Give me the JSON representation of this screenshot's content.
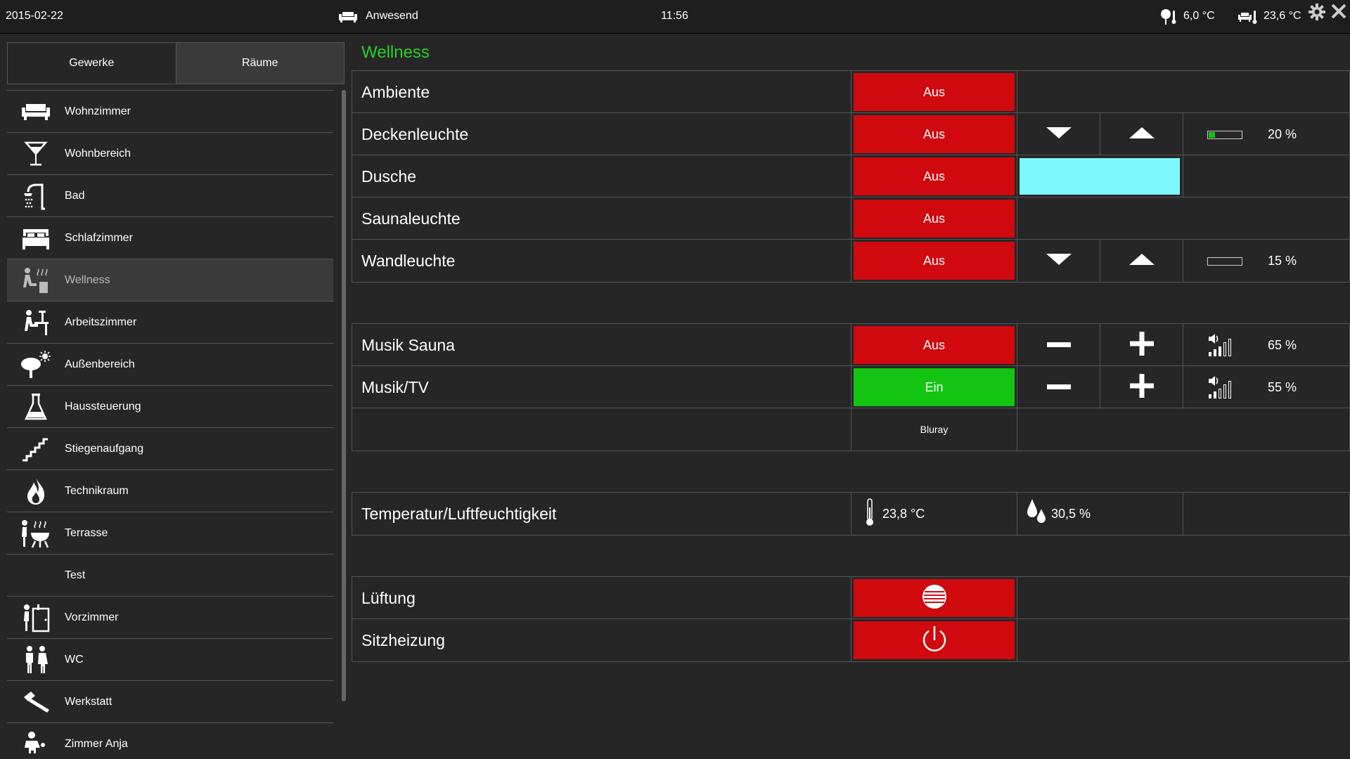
{
  "topbar": {
    "date": "2015-02-22",
    "presence": "Anwesend",
    "time": "11:56",
    "outdoor_temp": "6,0 °C",
    "indoor_temp": "23,6 °C"
  },
  "sidebar": {
    "tabs": [
      "Gewerke",
      "Räume"
    ],
    "rooms": [
      {
        "label": "Wohnzimmer",
        "icon": "sofa-icon"
      },
      {
        "label": "Wohnbereich",
        "icon": "cocktail-glass-icon"
      },
      {
        "label": "Bad",
        "icon": "shower-icon"
      },
      {
        "label": "Schlafzimmer",
        "icon": "bed-icon"
      },
      {
        "label": "Wellness",
        "icon": "sauna-icon"
      },
      {
        "label": "Arbeitszimmer",
        "icon": "desk-worker-icon"
      },
      {
        "label": "Außenbereich",
        "icon": "tree-sun-icon"
      },
      {
        "label": "Haussteuerung",
        "icon": "flask-icon"
      },
      {
        "label": "Stiegenaufgang",
        "icon": "stairs-icon"
      },
      {
        "label": "Technikraum",
        "icon": "flame-icon"
      },
      {
        "label": "Terrasse",
        "icon": "grill-icon"
      },
      {
        "label": "Test",
        "icon": ""
      },
      {
        "label": "Vorzimmer",
        "icon": "coat-rack-icon"
      },
      {
        "label": "WC",
        "icon": "restroom-icon"
      },
      {
        "label": "Werkstatt",
        "icon": "hammer-icon"
      },
      {
        "label": "Zimmer Anja",
        "icon": "child-icon"
      }
    ],
    "active": "Wellness"
  },
  "main": {
    "title": "Wellness",
    "lights": [
      {
        "label": "Ambiente",
        "state": "Aus"
      },
      {
        "label": "Deckenleuchte",
        "state": "Aus",
        "level": "20 %",
        "level_fraction": 0.2
      },
      {
        "label": "Dusche",
        "state": "Aus",
        "color": "#7df8fd"
      },
      {
        "label": "Saunaleuchte",
        "state": "Aus"
      },
      {
        "label": "Wandleuchte",
        "state": "Aus",
        "level": "15 %",
        "level_fraction": 0.0
      }
    ],
    "audio": [
      {
        "label": "Musik Sauna",
        "state": "Aus",
        "volume": "65 %"
      },
      {
        "label": "Musik/TV",
        "state": "Ein",
        "volume": "55 %"
      }
    ],
    "source": "Bluray",
    "climate": {
      "label": "Temperatur/Luftfeuchtigkeit",
      "temperature": "23,8 °C",
      "humidity": "30,5 %"
    },
    "devices": [
      {
        "label": "Lüftung",
        "icon": "fan-grille-icon"
      },
      {
        "label": "Sitzheizung",
        "icon": "power-icon"
      }
    ]
  },
  "colors": {
    "off": "#d0090f",
    "on": "#13c413",
    "title": "#2ad02a",
    "shower_light": "#7df8fd"
  }
}
